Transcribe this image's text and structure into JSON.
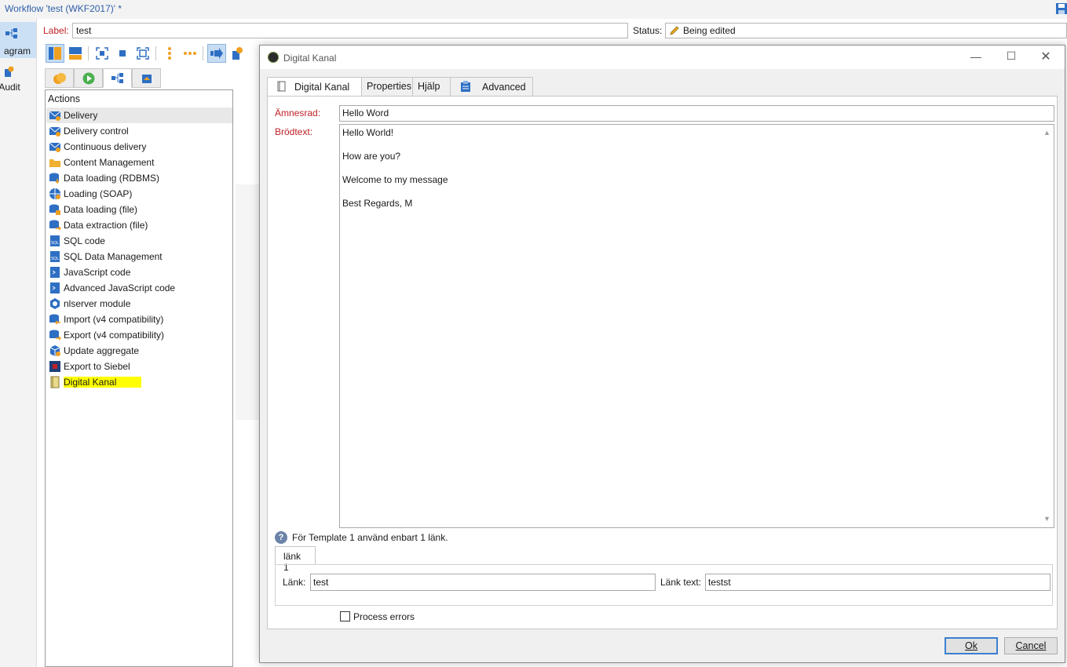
{
  "window": {
    "title": "Workflow 'test (WKF2017)' *"
  },
  "views": [
    {
      "label": "agram",
      "active": true
    },
    {
      "label": "Audit",
      "active": false
    }
  ],
  "header": {
    "label_caption": "Label:",
    "label_value": "test",
    "status_caption": "Status:",
    "status_value": "Being edited"
  },
  "palette": {
    "heading": "Actions",
    "items": [
      {
        "label": "Delivery",
        "icon": "envelope-icon"
      },
      {
        "label": "Delivery control",
        "icon": "envelope-gear-icon"
      },
      {
        "label": "Continuous delivery",
        "icon": "envelope-loop-icon"
      },
      {
        "label": "Content Management",
        "icon": "folder-icon"
      },
      {
        "label": "Data loading (RDBMS)",
        "icon": "database-down-icon"
      },
      {
        "label": "Loading (SOAP)",
        "icon": "globe-database-icon"
      },
      {
        "label": "Data loading (file)",
        "icon": "database-file-icon"
      },
      {
        "label": "Data extraction (file)",
        "icon": "database-export-icon"
      },
      {
        "label": "SQL code",
        "icon": "sql-file-icon"
      },
      {
        "label": "SQL Data Management",
        "icon": "sql-file-icon"
      },
      {
        "label": "JavaScript code",
        "icon": "script-file-icon"
      },
      {
        "label": "Advanced JavaScript code",
        "icon": "script-file-icon"
      },
      {
        "label": "nlserver module",
        "icon": "hex-module-icon"
      },
      {
        "label": "Import (v4 compatibility)",
        "icon": "database-import-icon"
      },
      {
        "label": "Export (v4 compatibility)",
        "icon": "database-export-icon"
      },
      {
        "label": "Update aggregate",
        "icon": "cube-icon"
      },
      {
        "label": "Export to Siebel",
        "icon": "siebel-icon"
      },
      {
        "label": "Digital Kanal",
        "icon": "book-icon"
      }
    ]
  },
  "dialog": {
    "title": "Digital Kanal",
    "tabs": [
      {
        "label": "Digital Kanal",
        "active": true
      },
      {
        "label": "Properties",
        "active": false
      },
      {
        "label": "Hjälp",
        "active": false
      },
      {
        "label": "Advanced",
        "active": false
      }
    ],
    "subject_label": "Ämnesrad:",
    "subject_value": "Hello Word",
    "body_label": "Brödtext:",
    "body_lines": [
      "Hello World!",
      "How are you?",
      "Welcome to my message",
      "Best Regards, M"
    ],
    "hint": "För Template 1 använd enbart 1 länk.",
    "link_tab": "länk 1",
    "link_label": "Länk:",
    "link_value": "test",
    "link_text_label": "Länk text:",
    "link_text_value": "testst",
    "process_errors_label": "Process errors",
    "process_errors_checked": false,
    "ok_label": "Ok",
    "cancel_label": "Cancel"
  },
  "colors": {
    "accent": "#2e5fa8",
    "required": "#c02026",
    "highlight": "#ffff00",
    "orange": "#f0a020"
  }
}
